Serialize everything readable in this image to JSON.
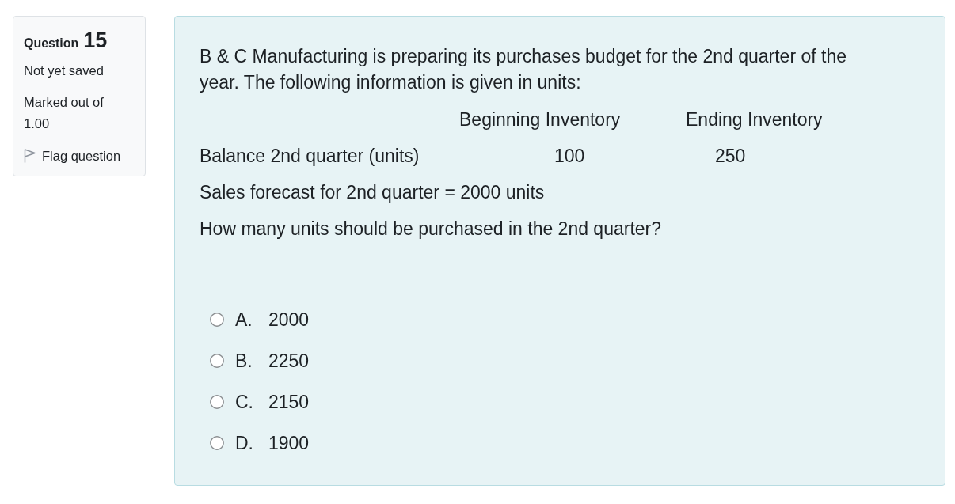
{
  "question_info": {
    "label": "Question",
    "number": "15",
    "status": "Not yet saved",
    "marks": "Marked out of 1.00",
    "flag": {
      "label": "Flag question",
      "flagged": false
    }
  },
  "question": {
    "text": "B & C Manufacturing is preparing its purchases budget for the 2nd quarter of the year. The following information is given in units:",
    "table": {
      "columns": [
        "Beginning Inventory",
        "Ending Inventory"
      ],
      "rows": [
        {
          "label": "Balance 2nd quarter (units)",
          "values": [
            "100",
            "250"
          ]
        }
      ]
    },
    "sales_forecast": "Sales forecast for 2nd quarter = 2000 units",
    "prompt": "How many units should be purchased in the 2nd quarter?"
  },
  "options": [
    {
      "letter": "A.",
      "text": "2000",
      "selected": false
    },
    {
      "letter": "B.",
      "text": "2250",
      "selected": false
    },
    {
      "letter": "C.",
      "text": "2150",
      "selected": false
    },
    {
      "letter": "D.",
      "text": "1900",
      "selected": false
    }
  ]
}
